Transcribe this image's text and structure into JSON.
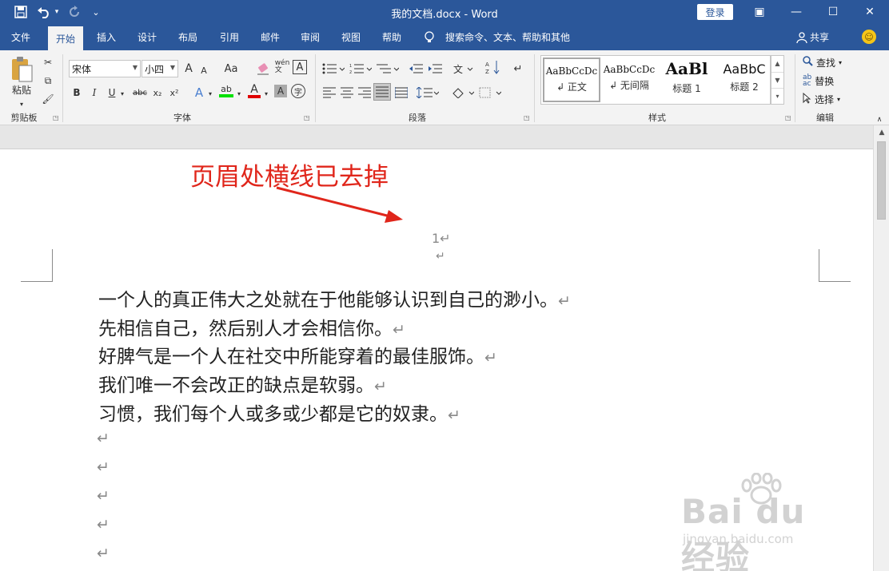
{
  "window": {
    "title": "我的文档.docx  -  Word",
    "login_label": "登录",
    "controls": {
      "ribbon_options": "▣",
      "minimize": "—",
      "maximize": "☐",
      "close": "✕"
    }
  },
  "quick_access": {
    "save_icon": "💾",
    "undo_icon": "↶",
    "undo_dropdown": "▾",
    "redo_icon": "↻",
    "customize": "⌄"
  },
  "menu": {
    "tabs": [
      "文件",
      "开始",
      "插入",
      "设计",
      "布局",
      "引用",
      "邮件",
      "审阅",
      "视图",
      "帮助"
    ],
    "active_tab": "开始",
    "search_placeholder": "搜索命令、文本、帮助和其他",
    "share_label": "共享",
    "feedback_icon": "☺"
  },
  "ribbon": {
    "clipboard": {
      "paste_label": "粘贴",
      "label": "剪贴板"
    },
    "font": {
      "font_name": "宋体",
      "font_size": "小四",
      "grow": "A",
      "shrink": "A",
      "change_case": "Aa",
      "bold": "B",
      "italic": "I",
      "underline": "U",
      "strikethrough": "abc",
      "subscript": "x₂",
      "superscript": "x²",
      "text_effects": "A",
      "font_color": "A",
      "char_shading": "A",
      "enclose": "字",
      "label": "字体"
    },
    "paragraph": {
      "label": "段落"
    },
    "styles": {
      "items": [
        {
          "sample": "AaBbCcDc",
          "name": "↲ 正文"
        },
        {
          "sample": "AaBbCcDc",
          "name": "↲ 无间隔"
        },
        {
          "sample": "AaBl",
          "name": "标题 1"
        },
        {
          "sample": "AaBbC",
          "name": "标题 2"
        }
      ],
      "label": "样式"
    },
    "editing": {
      "find": "查找",
      "replace": "替换",
      "select": "选择",
      "label": "编辑"
    }
  },
  "document": {
    "annotation": "页眉处横线已去掉",
    "header_page_number": "1↵",
    "header_mark": "↵",
    "lines": [
      "一个人的真正伟大之处就在于他能够认识到自己的渺小。",
      "先相信自己，然后别人才会相信你。",
      "好脾气是一个人在社交中所能穿着的最佳服饰。",
      "我们唯一不会改正的缺点是软弱。",
      "习惯，我们每个人或多或少都是它的奴隶。"
    ],
    "paragraph_mark": "↵",
    "empty_marks": [
      "↵",
      "↵",
      "↵",
      "↵",
      "↵"
    ]
  },
  "watermark": {
    "main": "Bai du 经验",
    "sub": "jingyan.baidu.com"
  },
  "colors": {
    "title_bar": "#2b579a",
    "annotation_red": "#e0261b",
    "highlight_green": "#00e000",
    "font_red": "#e00000"
  }
}
